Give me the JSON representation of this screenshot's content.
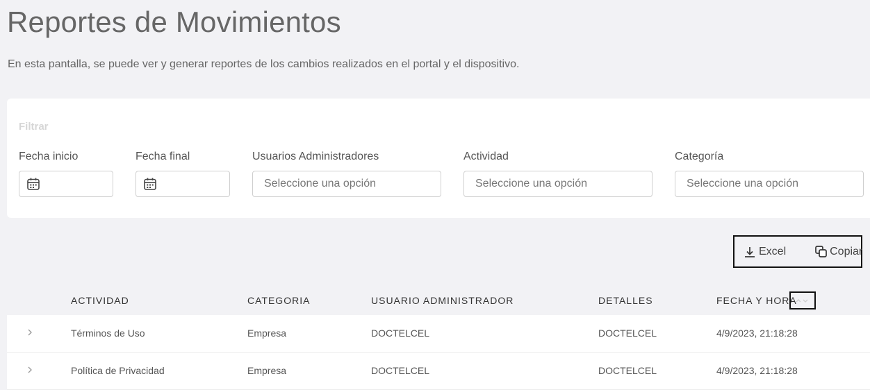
{
  "page": {
    "title": "Reportes de Movimientos",
    "subtitle": "En esta pantalla, se puede ver y generar reportes de los cambios realizados en el portal y el dispositivo."
  },
  "filter": {
    "heading": "Filtrar",
    "fields": [
      {
        "label": "Fecha inicio",
        "value": "",
        "icon": "calendar-icon"
      },
      {
        "label": "Fecha final",
        "value": "",
        "icon": "calendar-icon"
      },
      {
        "label": "Usuarios Administradores",
        "placeholder": "Seleccione una opción"
      },
      {
        "label": "Actividad",
        "placeholder": "Seleccione una opción"
      },
      {
        "label": "Categoría",
        "placeholder": "Seleccione una opción"
      }
    ]
  },
  "toolbar": {
    "excel_label": "Excel",
    "excel_icon": "download-icon",
    "copy_label": "Copiar",
    "copy_icon": "copy-icon"
  },
  "table": {
    "columns": [
      "ACTIVIDAD",
      "CATEGORIA",
      "USUARIO ADMINISTRADOR",
      "DETALLES",
      "FECHA Y HORA"
    ],
    "sort_icon": "sort-icon",
    "rows": [
      {
        "actividad": "Términos de Uso",
        "categoria": "Empresa",
        "usuario": "DOCTELCEL",
        "detalles": "DOCTELCEL",
        "fecha": "4/9/2023, 21:18:28"
      },
      {
        "actividad": "Política de Privacidad",
        "categoria": "Empresa",
        "usuario": "DOCTELCEL",
        "detalles": "DOCTELCEL",
        "fecha": "4/9/2023, 21:18:28"
      }
    ]
  },
  "colors": {
    "background": "#f2f2f5",
    "card": "#ffffff",
    "border": "#cfcfcf",
    "heading_muted": "#d6d6d6"
  }
}
